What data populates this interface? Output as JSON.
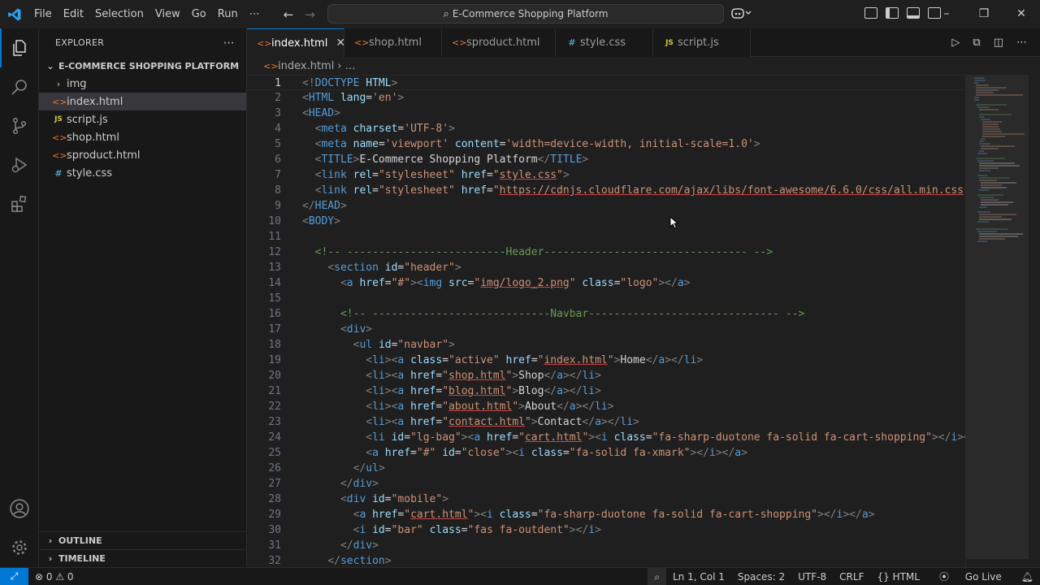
{
  "titlebar": {
    "menu": [
      "File",
      "Edit",
      "Selection",
      "View",
      "Go",
      "Run",
      "⋯"
    ],
    "search_text": "E-Commerce Shopping Platform"
  },
  "explorer": {
    "title": "EXPLORER",
    "more": "⋯",
    "root": "E-COMMERCE SHOPPING PLATFORM",
    "items": [
      {
        "name": "img",
        "type": "folder"
      },
      {
        "name": "index.html",
        "type": "html",
        "selected": true
      },
      {
        "name": "script.js",
        "type": "js"
      },
      {
        "name": "shop.html",
        "type": "html"
      },
      {
        "name": "sproduct.html",
        "type": "html"
      },
      {
        "name": "style.css",
        "type": "css"
      }
    ],
    "outline": "OUTLINE",
    "timeline": "TIMELINE"
  },
  "tabs": [
    {
      "label": "index.html",
      "type": "html",
      "active": true
    },
    {
      "label": "shop.html",
      "type": "html"
    },
    {
      "label": "sproduct.html",
      "type": "html"
    },
    {
      "label": "style.css",
      "type": "css"
    },
    {
      "label": "script.js",
      "type": "js"
    }
  ],
  "breadcrumb": {
    "file": "index.html",
    "rest": "…"
  },
  "editor": {
    "line_numbers": [
      "1",
      "2",
      "3",
      "4",
      "5",
      "6",
      "7",
      "8",
      "9",
      "10",
      "11",
      "12",
      "13",
      "14",
      "15",
      "16",
      "17",
      "18",
      "19",
      "20",
      "21",
      "22",
      "23",
      "24",
      "25",
      "26",
      "27",
      "28",
      "29",
      "30",
      "31",
      "32"
    ],
    "current_line": "1"
  },
  "statusbar": {
    "problems": "⊗ 0 ⚠ 0",
    "position": "Ln 1, Col 1",
    "spaces": "Spaces: 2",
    "encoding": "UTF-8",
    "eol": "CRLF",
    "language": "{} HTML",
    "golive": "Go Live"
  },
  "colors": {
    "accent": "#0078d4",
    "tag": "#569cd6",
    "attr": "#9cdcfe",
    "string": "#ce9178",
    "comment": "#6a9955"
  }
}
